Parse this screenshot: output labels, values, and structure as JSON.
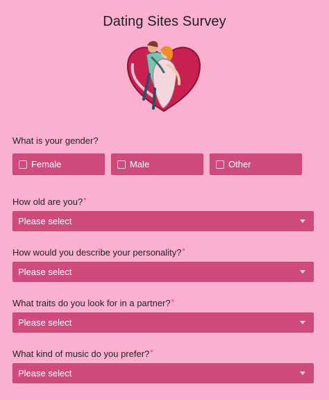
{
  "page": {
    "title": "Dating Sites Survey",
    "hero_icon": "couple-heart-illustration"
  },
  "questions": {
    "gender": {
      "label": "What is your gender?",
      "options": [
        "Female",
        "Male",
        "Other"
      ]
    },
    "age": {
      "label": "How old are you?",
      "required_mark": "*",
      "value": "Please select"
    },
    "personality": {
      "label": "How would you describe your personality?",
      "required_mark": "*",
      "value": "Please select"
    },
    "traits": {
      "label": "What traits do you look for in a partner?",
      "required_mark": "*",
      "value": "Please select"
    },
    "music": {
      "label": "What kind of music do you prefer?",
      "required_mark": "*",
      "value": "Please select"
    }
  },
  "colors": {
    "background": "#fbb0cf",
    "control": "#cf4b7c",
    "required": "#ff2a6a"
  }
}
